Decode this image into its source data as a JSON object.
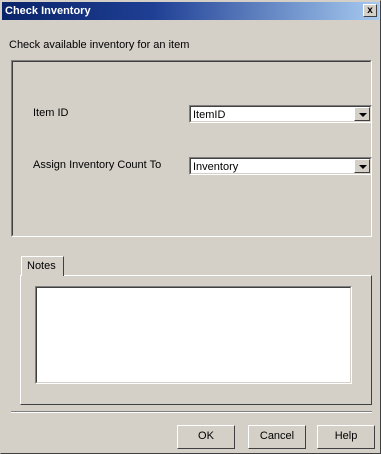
{
  "window": {
    "title": "Check Inventory",
    "close_label": "x"
  },
  "intro_text": "Check available inventory for an item",
  "form": {
    "item_id": {
      "label": "Item ID",
      "value": "ItemID"
    },
    "assign_count": {
      "label": "Assign Inventory Count To",
      "value": "Inventory"
    }
  },
  "notes": {
    "tab_label": "Notes",
    "value": ""
  },
  "buttons": {
    "ok": "OK",
    "cancel": "Cancel",
    "help": "Help"
  },
  "colors": {
    "title_bar": "#0a246a",
    "dialog_bg": "#d4d0c8"
  }
}
